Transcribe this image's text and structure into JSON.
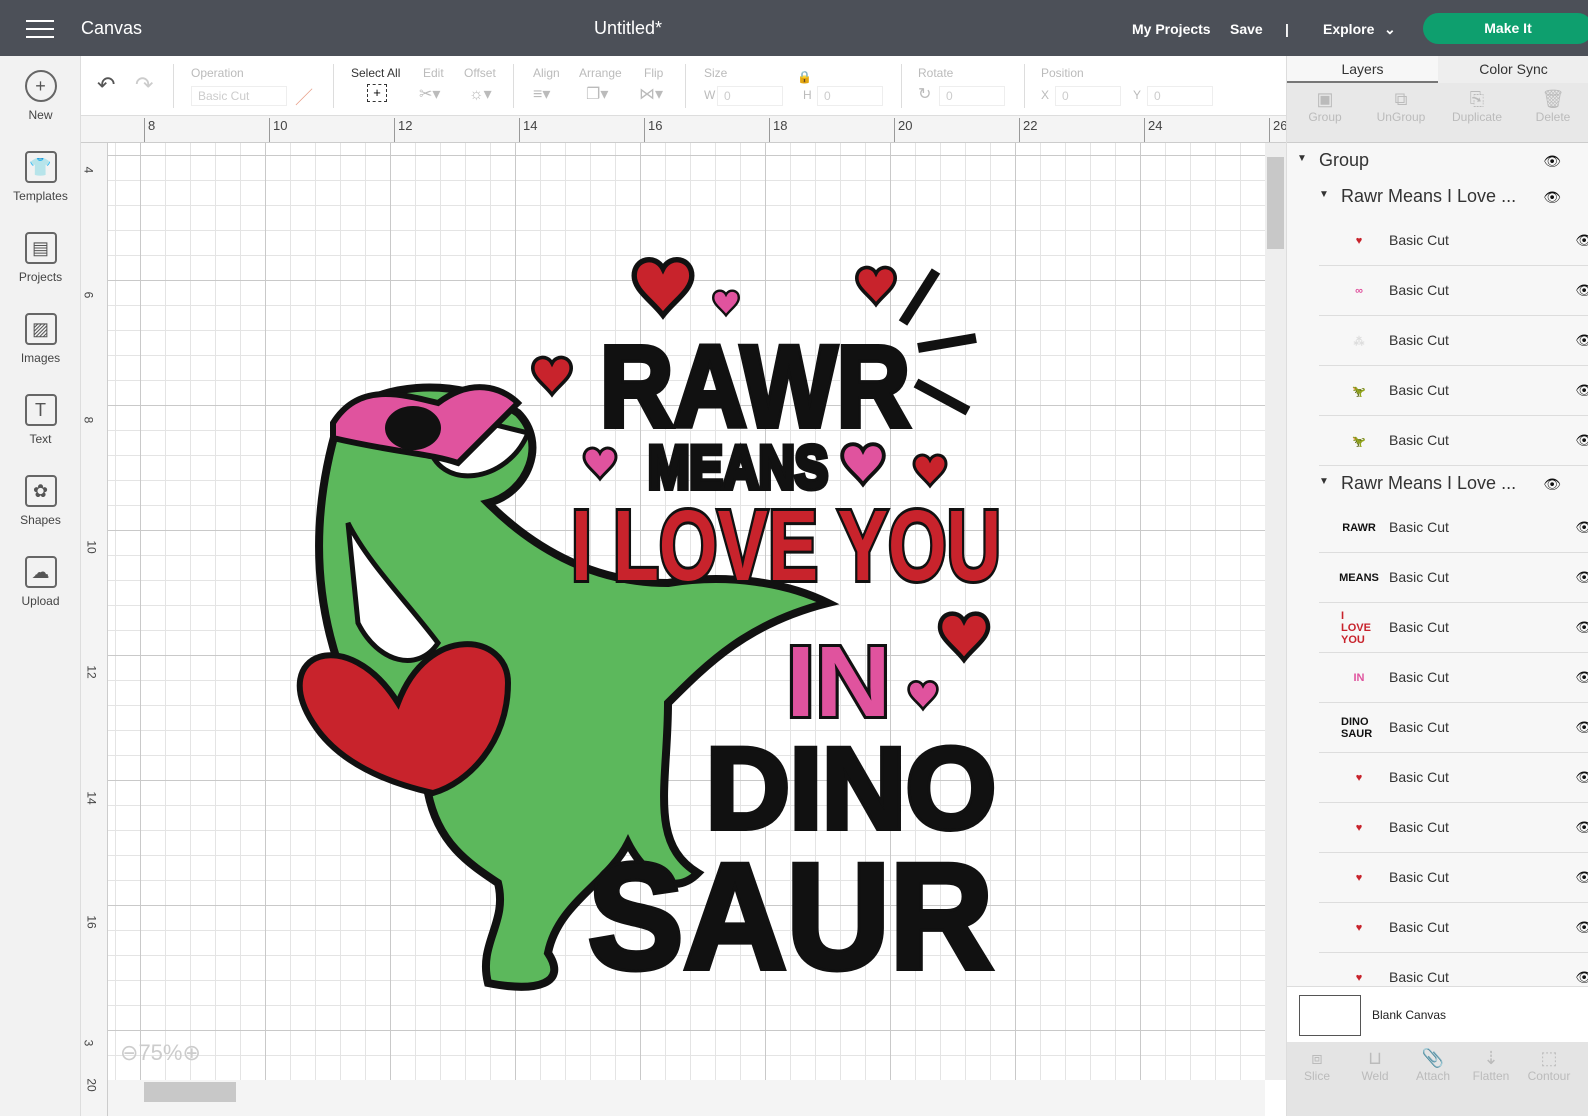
{
  "header": {
    "app": "Canvas",
    "title": "Untitled*",
    "my_projects": "My Projects",
    "save": "Save",
    "divider": "|",
    "explore": "Explore",
    "make_it": "Make It"
  },
  "sidebar": [
    {
      "label": "New",
      "icon": "+"
    },
    {
      "label": "Templates",
      "icon": "👕"
    },
    {
      "label": "Projects",
      "icon": "▤"
    },
    {
      "label": "Images",
      "icon": "▨"
    },
    {
      "label": "Text",
      "icon": "T"
    },
    {
      "label": "Shapes",
      "icon": "✿"
    },
    {
      "label": "Upload",
      "icon": "☁"
    }
  ],
  "toolbar": {
    "operation": "Operation",
    "operation_value": "Basic Cut",
    "select_all": "Select All",
    "edit": "Edit",
    "offset": "Offset",
    "align": "Align",
    "arrange": "Arrange",
    "flip": "Flip",
    "size": "Size",
    "w": "W",
    "h": "H",
    "w_val": "0",
    "h_val": "0",
    "rotate": "Rotate",
    "rotate_val": "0",
    "position": "Position",
    "x": "X",
    "y": "Y",
    "x_val": "0",
    "y_val": "0"
  },
  "ruler_h": [
    "8",
    "10",
    "12",
    "14",
    "16",
    "18",
    "20",
    "22",
    "24",
    "26"
  ],
  "ruler_v": [
    "4",
    "6",
    "8",
    "10",
    "12",
    "14",
    "16",
    "3",
    "20"
  ],
  "zoom": "75%",
  "artwork": {
    "line1": "RAWR",
    "line2": "MEANS",
    "line3": "I LOVE YOU",
    "line4": "IN",
    "line5": "DINO",
    "line6": "SAUR",
    "colors": {
      "red": "#c8232c",
      "pink": "#e0539e",
      "green": "#5cb85c",
      "black": "#111111"
    }
  },
  "panel": {
    "tabs": [
      "Layers",
      "Color Sync"
    ],
    "actions": [
      "Group",
      "UnGroup",
      "Duplicate",
      "Delete"
    ],
    "group": "Group",
    "subgroup1": "Rawr Means I Love ...",
    "subgroup2": "Rawr Means I Love ...",
    "layers1": [
      {
        "label": "Basic Cut",
        "thumb": "♥",
        "color": "#c8232c"
      },
      {
        "label": "Basic Cut",
        "thumb": "∞",
        "color": "#e0539e"
      },
      {
        "label": "Basic Cut",
        "thumb": "⁂",
        "color": "#ddd"
      },
      {
        "label": "Basic Cut",
        "thumb": "🦖",
        "color": "#5cb85c"
      },
      {
        "label": "Basic Cut",
        "thumb": "🦖",
        "color": "#111"
      }
    ],
    "layers2": [
      {
        "label": "Basic Cut",
        "thumb": "RAWR",
        "color": "#111"
      },
      {
        "label": "Basic Cut",
        "thumb": "MEANS",
        "color": "#111"
      },
      {
        "label": "Basic Cut",
        "thumb": "I LOVE YOU",
        "color": "#c8232c"
      },
      {
        "label": "Basic Cut",
        "thumb": "IN",
        "color": "#e0539e"
      },
      {
        "label": "Basic Cut",
        "thumb": "DINO SAUR",
        "color": "#111"
      },
      {
        "label": "Basic Cut",
        "thumb": "♥",
        "color": "#c8232c"
      },
      {
        "label": "Basic Cut",
        "thumb": "♥",
        "color": "#c8232c"
      },
      {
        "label": "Basic Cut",
        "thumb": "♥",
        "color": "#c8232c"
      },
      {
        "label": "Basic Cut",
        "thumb": "♥",
        "color": "#c8232c"
      },
      {
        "label": "Basic Cut",
        "thumb": "♥",
        "color": "#c8232c"
      }
    ],
    "blank_canvas": "Blank Canvas",
    "bottom": [
      "Slice",
      "Weld",
      "Attach",
      "Flatten",
      "Contour"
    ]
  }
}
